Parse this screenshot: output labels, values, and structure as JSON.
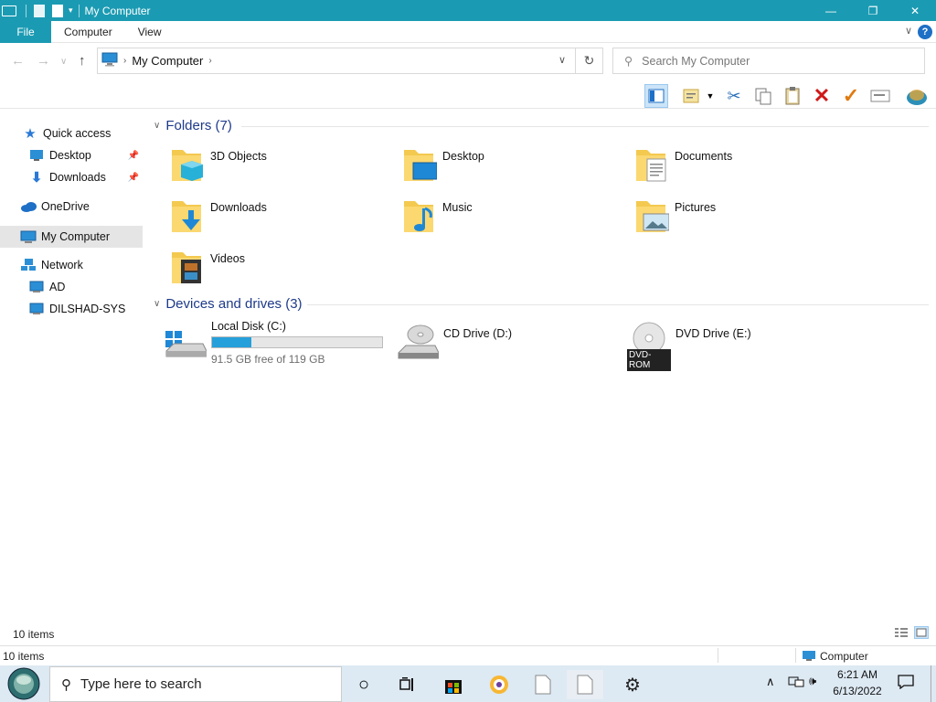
{
  "window": {
    "title": "My Computer",
    "controls": {
      "minimize": "—",
      "maximize": "❐",
      "close": "✕"
    }
  },
  "ribbon": {
    "tabs": [
      "File",
      "Computer",
      "View"
    ],
    "help": "?"
  },
  "address": {
    "path": "My Computer",
    "search_placeholder": "Search My Computer"
  },
  "sidebar": {
    "items": [
      {
        "label": "Quick access",
        "icon": "star-icon"
      },
      {
        "label": "Desktop",
        "icon": "desktop-icon",
        "pinned": true
      },
      {
        "label": "Downloads",
        "icon": "download-icon",
        "pinned": true
      },
      {
        "label": "OneDrive",
        "icon": "cloud-icon"
      },
      {
        "label": "My Computer",
        "icon": "computer-icon",
        "selected": true
      },
      {
        "label": "Network",
        "icon": "network-icon"
      },
      {
        "label": "AD",
        "icon": "computer-icon"
      },
      {
        "label": "DILSHAD-SYS",
        "icon": "computer-icon"
      }
    ]
  },
  "folders": {
    "header": "Folders (7)",
    "items": [
      {
        "label": "3D Objects"
      },
      {
        "label": "Desktop"
      },
      {
        "label": "Documents"
      },
      {
        "label": "Downloads"
      },
      {
        "label": "Music"
      },
      {
        "label": "Pictures"
      },
      {
        "label": "Videos"
      }
    ]
  },
  "drives": {
    "header": "Devices and drives (3)",
    "items": [
      {
        "label": "Local Disk (C:)",
        "free_text": "91.5 GB free of 119 GB",
        "used_fraction": 0.23
      },
      {
        "label": "CD Drive (D:)"
      },
      {
        "label": "DVD Drive (E:)",
        "badge": "DVD-ROM"
      }
    ]
  },
  "status": {
    "items_count": "10 items",
    "bottom_items": "10 items",
    "bottom_location": "Computer"
  },
  "taskbar": {
    "search_placeholder": "Type here to search",
    "time": "6:21 AM",
    "date": "6/13/2022"
  },
  "colors": {
    "titlebar": "#1b9bb3",
    "accent": "#26a0da",
    "group_header": "#1e3a8a"
  }
}
